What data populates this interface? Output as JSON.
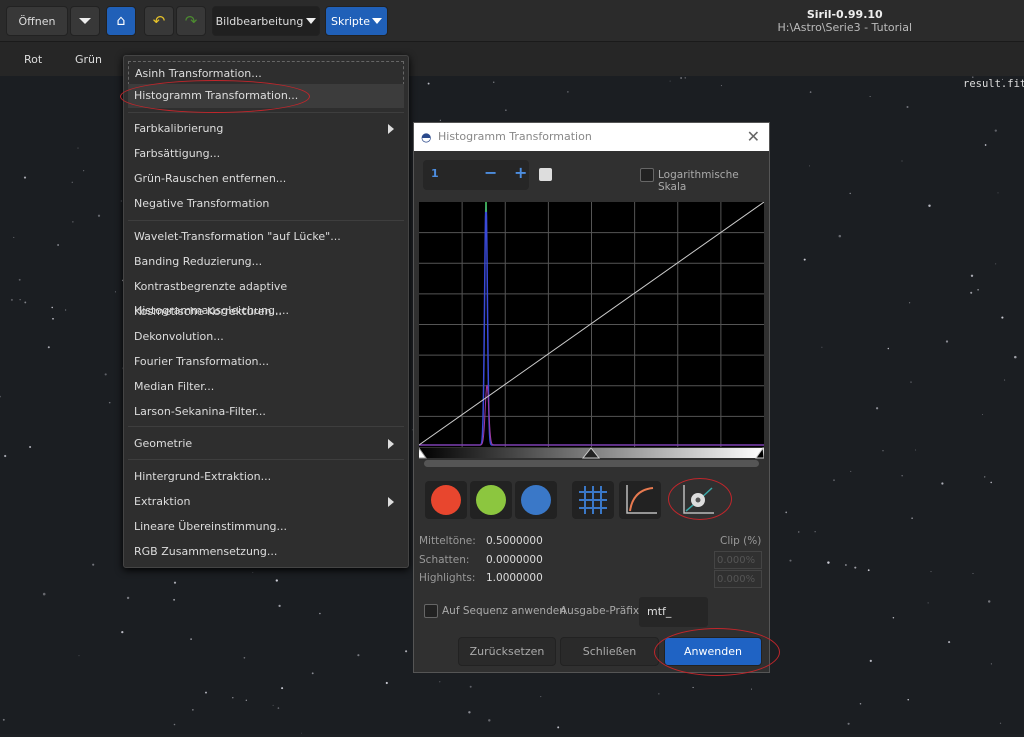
{
  "toolbar": {
    "open": "Öffnen",
    "image_processing": "Bildbearbeitung",
    "scripts": "Skripte"
  },
  "window": {
    "app": "Siril-0.99.10",
    "path": "H:\\Astro\\Serie3 - Tutorial"
  },
  "channels": {
    "red": "Rot",
    "green": "Grün"
  },
  "canvas": {
    "filename": "result.fit"
  },
  "menu": {
    "items": [
      "Asinh Transformation...",
      "Histogramm Transformation...",
      "Farbkalibrierung",
      "Farbsättigung...",
      "Grün-Rauschen entfernen...",
      "Negative Transformation",
      "Wavelet-Transformation \"auf Lücke\"...",
      "Banding Reduzierung...",
      "Kontrastbegrenzte adaptive Histogrammausgleichung....",
      "Kosmetische Korrekturen...",
      "Dekonvolution...",
      "Fourier Transformation...",
      "Median Filter...",
      "Larson-Sekanina-Filter...",
      "Geometrie",
      "Hintergrund-Extraktion...",
      "Extraktion",
      "Lineare Übereinstimmung...",
      "RGB Zusammensetzung..."
    ]
  },
  "dialog": {
    "title": "Histogramm Transformation",
    "zoom_value": "1",
    "log_scale": "Logarithmische Skala",
    "log_scale_checked": false,
    "channel_colors": {
      "red": "#e8462e",
      "green": "#8cc63f",
      "blue": "#3a78c8"
    },
    "midtones_label": "Mitteltöne:",
    "midtones": "0.5000000",
    "shadows_label": "Schatten:",
    "shadows": "0.0000000",
    "highlights_label": "Highlights:",
    "highlights": "1.0000000",
    "clip_label": "Clip (%)",
    "clip_low": "0.000%",
    "clip_high": "0.000%",
    "sequence_label": "Auf Sequenz anwenden",
    "sequence_checked": false,
    "prefix_label": "Ausgabe-Präfix:",
    "prefix": "mtf_",
    "reset": "Zurücksetzen",
    "close": "Schließen",
    "apply": "Anwenden"
  }
}
